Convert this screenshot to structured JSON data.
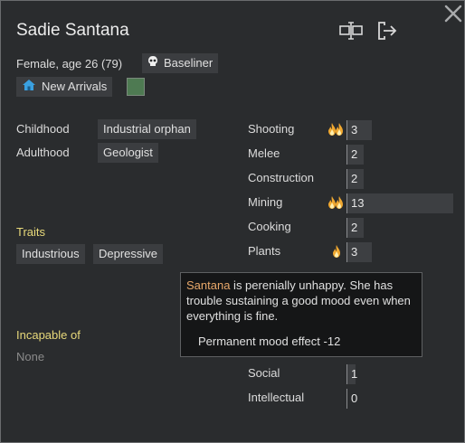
{
  "pawn": {
    "name": "Sadie Santana",
    "description": "Female, age 26 (79)",
    "xenotype": "Baseliner",
    "faction": "New Arrivals",
    "favorite_color": "#4e7a52"
  },
  "backstory": {
    "childhood_label": "Childhood",
    "childhood_value": "Industrial orphan",
    "adulthood_label": "Adulthood",
    "adulthood_value": "Geologist"
  },
  "traits": {
    "heading": "Traits",
    "items": [
      "Industrious",
      "Depressive"
    ]
  },
  "incapable": {
    "heading": "Incapable of",
    "value": "None"
  },
  "skills": [
    {
      "name": "Shooting",
      "level": "3",
      "passion": "major"
    },
    {
      "name": "Melee",
      "level": "2",
      "passion": "none"
    },
    {
      "name": "Construction",
      "level": "2",
      "passion": "none"
    },
    {
      "name": "Mining",
      "level": "13",
      "passion": "major"
    },
    {
      "name": "Cooking",
      "level": "2",
      "passion": "none"
    },
    {
      "name": "Plants",
      "level": "3",
      "passion": "minor"
    },
    {
      "name": "Social",
      "level": "1",
      "passion": "none"
    },
    {
      "name": "Intellectual",
      "level": "0",
      "passion": "none"
    }
  ],
  "tooltip": {
    "name": "Santana",
    "text": " is perenially unhappy. She has trouble sustaining a good mood even when everything is fine.",
    "effect": "Permanent mood effect -12"
  },
  "colors": {
    "heading_yellow": "#e8d97a",
    "tooltip_name": "#e8a86a",
    "flame": "#f0a830"
  },
  "icons": {
    "close": "close-icon",
    "rename": "rename-icon",
    "banish": "banish-icon",
    "xenotype": "skull-icon",
    "faction": "home-icon",
    "passion": "flame-icon"
  }
}
